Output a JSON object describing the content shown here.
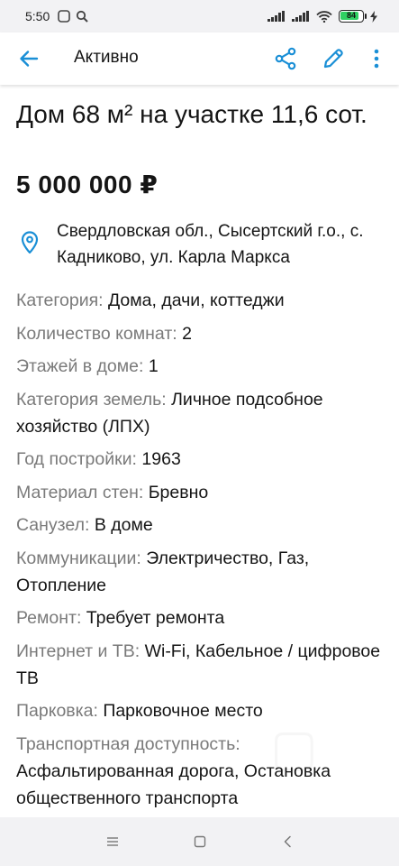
{
  "status_bar": {
    "time": "5:50",
    "battery_level": "84",
    "battery_fraction": 0.84
  },
  "header": {
    "title": "Активно",
    "back_icon": "arrow-left-icon",
    "share_icon": "share-icon",
    "edit_icon": "pencil-icon",
    "more_icon": "more-vertical-icon"
  },
  "colors": {
    "accent": "#1a8fd6",
    "label_gray": "#7a7a7a",
    "battery_green": "#2fd162"
  },
  "listing": {
    "title": "Дом 68 м² на участке 11,6 сот.",
    "price": "5 000 000 ₽",
    "address": "Свердловская обл., Сысертский г.о., с. Кадниково, ул. Карла Маркса",
    "params": [
      {
        "label": "Категория:",
        "value": "Дома, дачи, коттеджи"
      },
      {
        "label": "Количество комнат:",
        "value": "2"
      },
      {
        "label": "Этажей в доме:",
        "value": "1"
      },
      {
        "label": "Категория земель:",
        "value": "Личное подсобное хозяйство (ЛПХ)"
      },
      {
        "label": "Год постройки:",
        "value": "1963"
      },
      {
        "label": "Материал стен:",
        "value": "Бревно"
      },
      {
        "label": "Санузел:",
        "value": "В доме"
      },
      {
        "label": "Коммуникации:",
        "value": "Электричество, Газ, Отопление"
      },
      {
        "label": "Ремонт:",
        "value": "Требует ремонта"
      },
      {
        "label": "Интернет и ТВ:",
        "value": "Wi-Fi, Кабельное / цифровое ТВ"
      },
      {
        "label": "Парковка:",
        "value": "Парковочное место"
      },
      {
        "label": "Транспортная доступность:",
        "value": "Асфальтированная дорога, Остановка общественного транспорта"
      }
    ]
  },
  "nav_bar": {
    "menu_icon": "menu-icon",
    "home_icon": "square-home-icon",
    "back_icon": "triangle-back-icon"
  }
}
